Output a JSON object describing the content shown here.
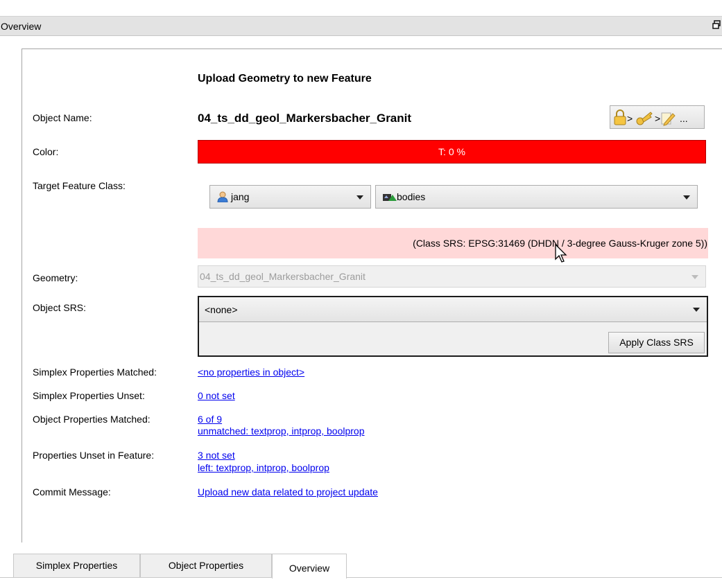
{
  "panel_title": "Overview",
  "heading": "Upload Geometry to new Feature",
  "labels": {
    "object_name": "Object Name:",
    "color": "Color:",
    "target_feature_class": "Target Feature Class:",
    "geometry": "Geometry:",
    "object_srs": "Object SRS:",
    "simplex_matched": "Simplex Properties Matched:",
    "simplex_unset": "Simplex Properties Unset:",
    "object_matched": "Object Properties Matched:",
    "props_unset": "Properties Unset in Feature:",
    "commit_message": "Commit Message:"
  },
  "object_name": "04_ts_dd_geol_Markersbacher_Granit",
  "lock_button_ellipsis": "...",
  "color_bar": {
    "text": "T: 0 %",
    "color": "#ff0000"
  },
  "target": {
    "user": "jang",
    "feature_class": "bodies"
  },
  "class_srs_text": "(Class SRS: EPSG:31469 (DHDN / 3-degree Gauss-Kruger zone 5))",
  "geometry_value": "04_ts_dd_geol_Markersbacher_Granit",
  "object_srs_value": "<none>",
  "apply_class_srs": "Apply Class SRS",
  "links": {
    "simplex_matched": "<no properties in object>",
    "simplex_unset": "0 not set",
    "object_matched": "6 of 9",
    "object_unmatched": "unmatched: textprop, intprop, boolprop",
    "props_unset": "3 not set",
    "props_left": "left: textprop, intprop, boolprop",
    "commit_message": "Upload new data related to project update"
  },
  "tabs": [
    "Simplex Properties",
    "Object Properties",
    "Overview"
  ],
  "active_tab": "Overview",
  "colors": {
    "link": "#0000ee",
    "srs_banner": "#ffd8d8",
    "titlebar": "#e3e3e3"
  },
  "icons": [
    "restore-icon",
    "lock-icon",
    "key-icon",
    "edit-icon",
    "user-icon",
    "folder-icon",
    "dropdown-arrow-icon",
    "mouse-cursor-icon"
  ]
}
